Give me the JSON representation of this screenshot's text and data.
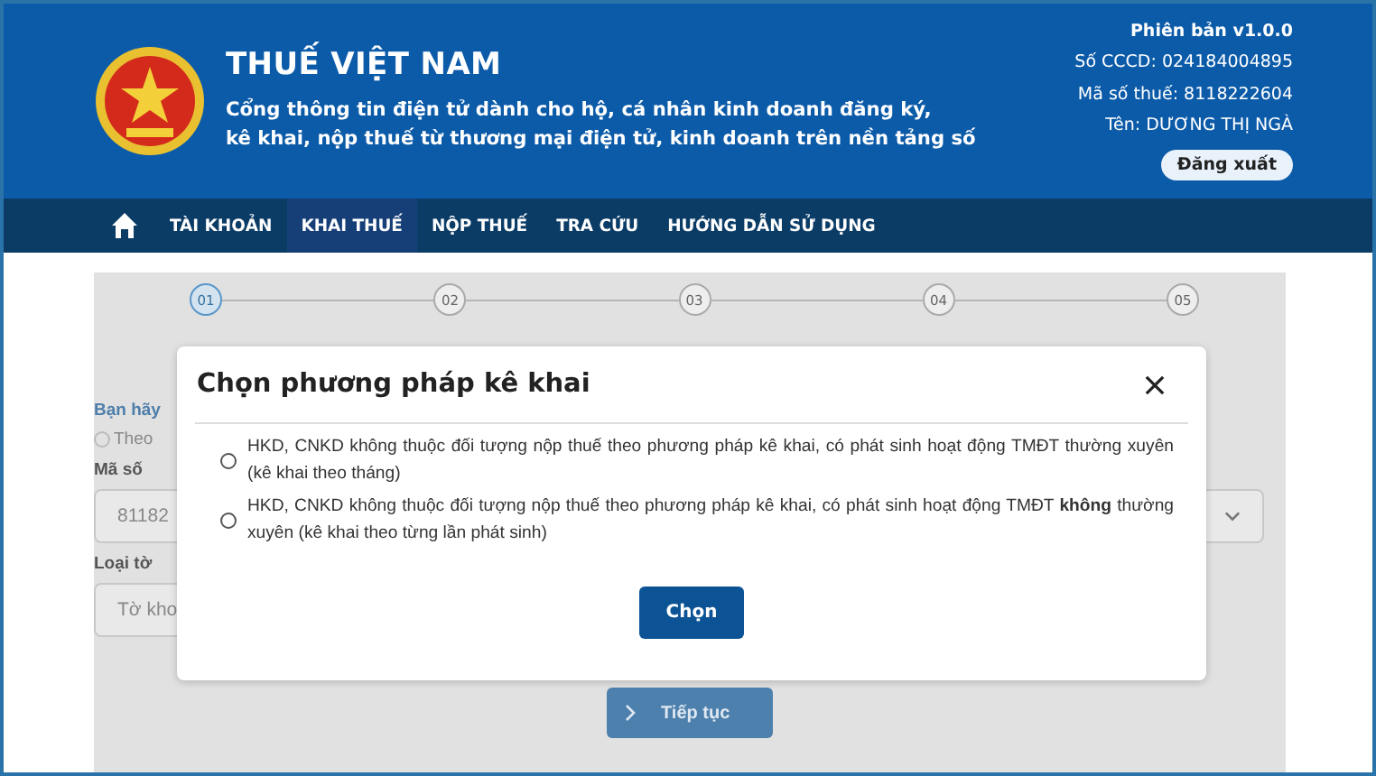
{
  "header": {
    "title": "THUẾ VIỆT NAM",
    "subtitle_lines": [
      "Cổng thông tin điện tử dành cho hộ, cá nhân kinh doanh đăng ký,",
      "kê khai, nộp thuế từ thương mại điện tử, kinh doanh trên nền tảng số"
    ],
    "version": "Phiên bản v1.0.0",
    "user_info": [
      "Số CCCD: 024184004895",
      "Mã số thuế: 8118222604",
      "Tên: DƯƠNG THỊ NGÀ"
    ],
    "logout_button": "Đăng xuất"
  },
  "nav": [
    {
      "label": "TÀI KHOẢN",
      "selected": false
    },
    {
      "label": "KHAI THUẾ",
      "selected": true
    },
    {
      "label": "NỘP THUẾ",
      "selected": false
    },
    {
      "label": "TRA CỨU",
      "selected": false
    },
    {
      "label": "HƯỚNG DẪN SỬ DỤNG",
      "selected": false
    }
  ],
  "steps": [
    {
      "number": "01",
      "selected": true
    },
    {
      "number": "02",
      "selected": false
    },
    {
      "number": "03",
      "selected": false
    },
    {
      "number": "04",
      "selected": false
    },
    {
      "number": "05",
      "selected": false
    }
  ],
  "form": {
    "prompt": "Bạn hãy",
    "radio_selected": false,
    "radio_label": "Theo",
    "tax_code_label": "Mã số",
    "tax_code_value": "81182",
    "form_type_label": "Loại tờ",
    "form_type_value": "Tờ kho",
    "continue_button": "Tiếp tục"
  },
  "dialog": {
    "title": "Chọn phương pháp kê khai",
    "options": [
      {
        "text": "HKD, CNKD không thuộc đối tượng nộp thuế theo phương pháp kê khai, có phát sinh hoạt động TMĐT thường xuyên (kê khai theo tháng)",
        "selected": false
      },
      {
        "text": "HKD, CNKD không thuộc đối tượng nộp thuế theo phương pháp kê khai, có phát sinh hoạt động TMĐT **không** thường xuyên (kê khai theo từng lần phát sinh)",
        "selected": false
      }
    ],
    "button": "Chọn"
  }
}
